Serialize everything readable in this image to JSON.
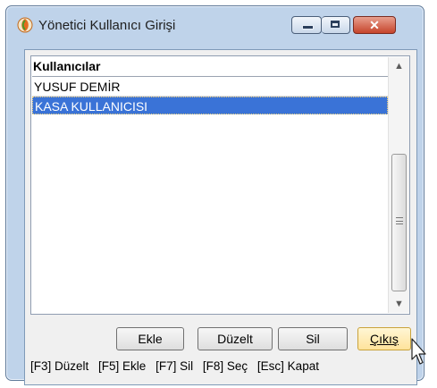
{
  "window": {
    "title": "Yönetici Kullanıcı Girişi",
    "icon": "app-swirl-icon",
    "controls": [
      "minimize-icon",
      "maximize-icon",
      "close-icon"
    ]
  },
  "list": {
    "header": "Kullanıcılar",
    "rows": [
      {
        "label": "YUSUF DEMİR",
        "selected": false
      },
      {
        "label": "KASA KULLANICISI",
        "selected": true
      }
    ],
    "scrollbar": {
      "up_arrow": "▲",
      "down_arrow": "▼"
    }
  },
  "buttons": {
    "add": "Ekle",
    "edit": "Düzelt",
    "delete": "Sil",
    "exit": "Çıkış"
  },
  "status_bar": {
    "items": [
      "[F3] Düzelt",
      "[F5] Ekle",
      "[F7] Sil",
      "[F8] Seç",
      "[Esc] Kapat"
    ]
  },
  "colors": {
    "selection": "#3a73d7",
    "close_button": "#c6442b",
    "frame": "#bfd3ea"
  }
}
